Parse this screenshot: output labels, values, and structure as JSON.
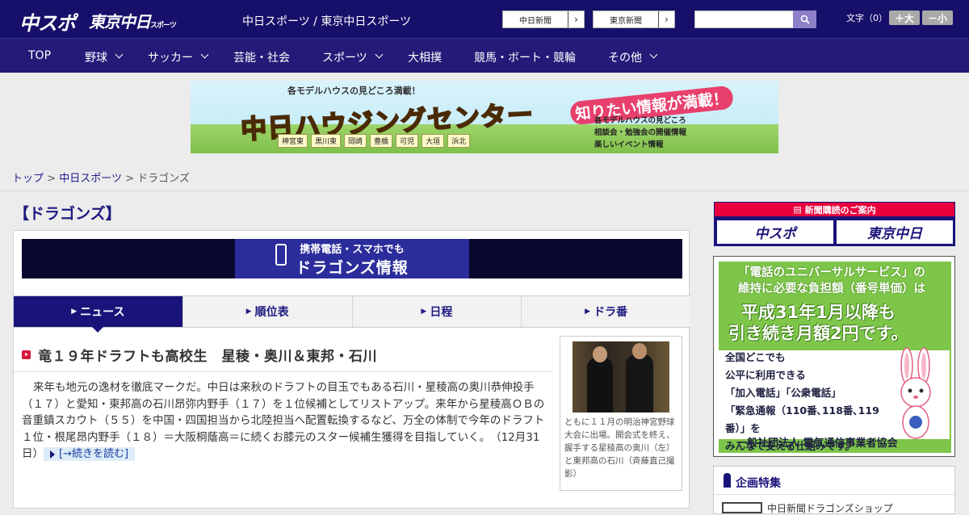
{
  "header": {
    "logo_chuspo": "中スポ",
    "logo_tokyo": "東京中日",
    "logo_tokyo_small": "スポーツ",
    "site_name": "中日スポーツ / 東京中日スポーツ",
    "ext_links": [
      "中日新聞",
      "東京新聞"
    ],
    "search": {
      "value": "",
      "placeholder": ""
    },
    "font_size_label": "文字（0）",
    "font_up": "＋大",
    "font_down": "－小"
  },
  "nav": {
    "items": [
      {
        "label": "TOP",
        "dropdown": false
      },
      {
        "label": "野球",
        "dropdown": true
      },
      {
        "label": "サッカー",
        "dropdown": true
      },
      {
        "label": "芸能・社会",
        "dropdown": false
      },
      {
        "label": "スポーツ",
        "dropdown": true
      },
      {
        "label": "大相撲",
        "dropdown": false
      },
      {
        "label": "競馬・ボート・競輪",
        "dropdown": false
      },
      {
        "label": "その他",
        "dropdown": true
      }
    ]
  },
  "ad_banner": {
    "top_text": "各モデルハウスの見どころ満載！",
    "main_text": "中日ハウジングセンター",
    "right_text": "知りたい情報が満載！",
    "list": [
      "各モデルハウスの見どころ",
      "相談会・勉強会の開催情報",
      "楽しいイベント情報"
    ],
    "towns": [
      "神宮東",
      "黒川東",
      "岡崎",
      "豊橋",
      "可児",
      "大垣",
      "浜北"
    ]
  },
  "breadcrumb": {
    "items": [
      "トップ",
      "中日スポーツ",
      "ドラゴンズ"
    ],
    "separator": ">"
  },
  "page_title": "【ドラゴンズ】",
  "mobile_ad": {
    "line1": "携帯電話・スマホでも",
    "line2": "ドラゴンズ情報"
  },
  "tabs": [
    {
      "label": "ニュース",
      "active": true
    },
    {
      "label": "順位表",
      "active": false
    },
    {
      "label": "日程",
      "active": false
    },
    {
      "label": "ドラ番",
      "active": false
    }
  ],
  "article": {
    "headline": "竜１９年ドラフトも高校生　星稜・奥川＆東邦・石川",
    "body": "来年も地元の逸材を徹底マークだ。中日は来秋のドラフトの目玉でもある石川・星稜高の奥川恭伸投手（１７）と愛知・東邦高の石川昂弥内野手（１７）を１位候補としてリストアップ。来年から星稜高ＯＢの音重鎮スカウト（５５）を中国・四国担当から北陸担当へ配置転換するなど、万全の体制で今年のドラフト１位・根尾昂内野手（１８）＝大阪桐蔭高＝に続くお膝元のスター候補生獲得を目指していく。",
    "date": "（12月31日）",
    "read_more": "[→続きを読む]",
    "photo_caption": "ともに１１月の明治神宮野球大会に出場。開会式を終え、握手する星稜高の奥川（左）と東邦高の石川（斉藤直己撮影）"
  },
  "sidebar": {
    "subscribe_header": "新聞購読のご案内",
    "subscribe_buttons": [
      "中スポ",
      "東京中日"
    ],
    "universal_ad": {
      "line1": "「電話のユニバーサルサービス」の",
      "line2": "維持に必要な負担額（番号単価）は",
      "line3": "平成31年1月以降も",
      "line4": "引き続き月額2円です。",
      "lines": [
        "全国どこでも",
        "公平に利用できる",
        "「加入電話」「公衆電話」",
        "「緊急通報（110番､118番､119番）」を",
        "みんなで支える仕組みです。"
      ],
      "footer": "一般社団法人 電気通信事業者協会"
    },
    "kikaku_header": "企画特集",
    "kikaku_item": "中日新聞ドラゴンズショップ"
  },
  "colors": {
    "header_bg": "#17106a",
    "nav_bg": "#241a78",
    "accent_red": "#d9163b",
    "link": "#1d1b8c"
  }
}
